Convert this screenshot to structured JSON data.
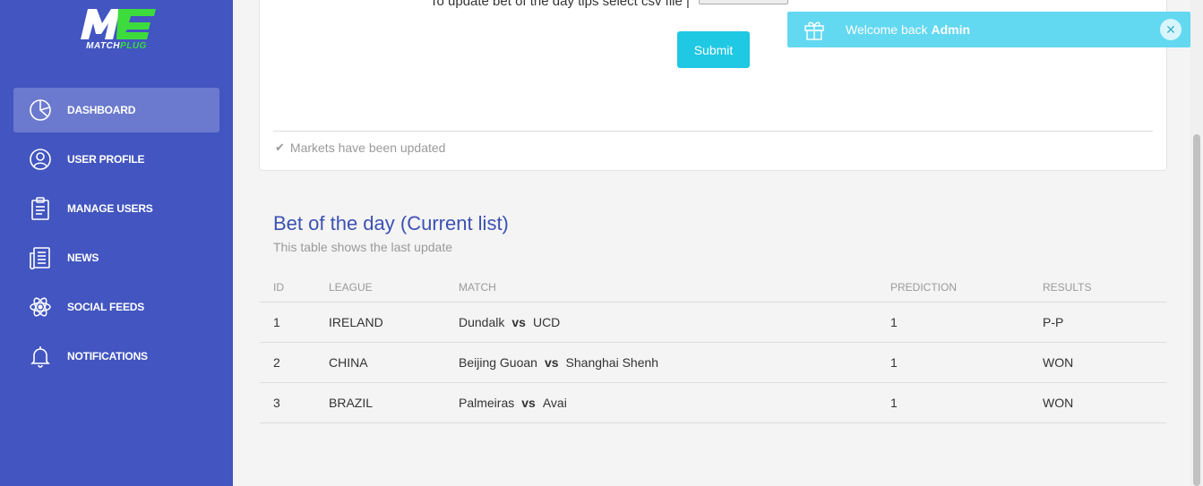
{
  "brand": {
    "logo_prefix": "MATCH",
    "logo_suffix": "PLUG"
  },
  "sidebar": {
    "items": [
      {
        "label": "DASHBOARD",
        "icon": "pie-chart-icon",
        "active": true
      },
      {
        "label": "USER PROFILE",
        "icon": "user-icon",
        "active": false
      },
      {
        "label": "MANAGE USERS",
        "icon": "clipboard-icon",
        "active": false
      },
      {
        "label": "NEWS",
        "icon": "newspaper-icon",
        "active": false
      },
      {
        "label": "SOCIAL FEEDS",
        "icon": "atom-icon",
        "active": false
      },
      {
        "label": "NOTIFICATIONS",
        "icon": "bell-icon",
        "active": false
      }
    ]
  },
  "upload": {
    "prompt": "To update bet of the day tips select csv file |",
    "submit_label": "Submit",
    "status": "Markets have been updated"
  },
  "toast": {
    "prefix": "Welcome back ",
    "user": "Admin",
    "close_glyph": "✕"
  },
  "table": {
    "title": "Bet of the day (Current list)",
    "subtitle": "This table shows the last update",
    "headers": [
      "ID",
      "LEAGUE",
      "MATCH",
      "PREDICTION",
      "RESULTS"
    ],
    "vs_label": "vs",
    "rows": [
      {
        "id": "1",
        "league": "IRELAND",
        "home": "Dundalk",
        "away": "UCD",
        "prediction": "1",
        "result": "P-P"
      },
      {
        "id": "2",
        "league": "CHINA",
        "home": "Beijing Guoan",
        "away": "Shanghai Shenh",
        "prediction": "1",
        "result": "WON"
      },
      {
        "id": "3",
        "league": "BRAZIL",
        "home": "Palmeiras",
        "away": "Avai",
        "prediction": "1",
        "result": "WON"
      }
    ]
  },
  "colors": {
    "sidebar": "#4255c0",
    "accent": "#1fc8e3",
    "toast": "#63d8f1",
    "title": "#3d51b3"
  }
}
